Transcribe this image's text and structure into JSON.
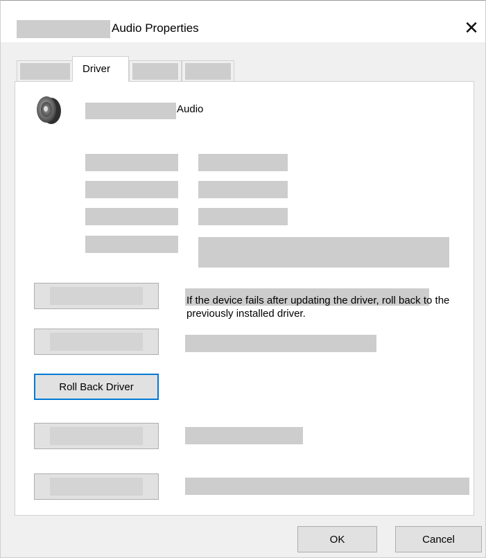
{
  "window": {
    "title": "Audio Properties",
    "close_glyph": "✕"
  },
  "tabs": [
    {
      "label": "",
      "active": false
    },
    {
      "label": "Driver",
      "active": true
    },
    {
      "label": "",
      "active": false
    },
    {
      "label": "",
      "active": false
    }
  ],
  "device": {
    "icon": "speaker-icon",
    "name_suffix": "Audio"
  },
  "buttons": {
    "roll_back_label": "Roll Back Driver",
    "roll_back_description": "If the device fails after updating the driver, roll back to the previously installed driver."
  },
  "footer": {
    "ok_label": "OK",
    "cancel_label": "Cancel"
  },
  "colors": {
    "accent": "#0078d7",
    "redacted": "#cdcdcd"
  }
}
